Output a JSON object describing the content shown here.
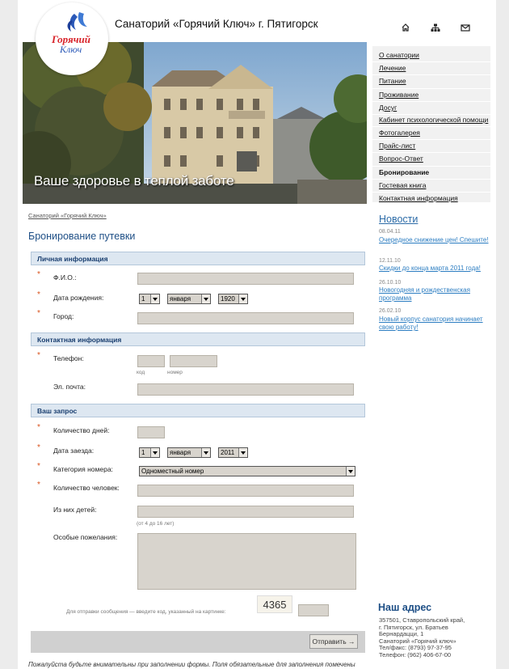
{
  "header": {
    "site_title": "Санаторий «Горячий Ключ» г. Пятигорск",
    "logo_text": "Горячий Ключ",
    "icons": [
      "home-icon",
      "sitemap-icon",
      "mail-icon"
    ]
  },
  "hero": {
    "slogan": "Ваше здоровье в теплой заботе"
  },
  "nav": {
    "items": [
      "О санатории",
      "Лечение",
      "Питание",
      "Проживание",
      "Досуг",
      "Кабинет психологической помощи",
      "Фотогалерея",
      "Прайс-лист",
      "Вопрос-Ответ",
      "Бронирование",
      "Гостевая книга",
      "Контактная информация"
    ],
    "active": "Бронирование"
  },
  "breadcrumb": "Санаторий «Горячий Ключ»",
  "form": {
    "title": "Бронирование путевки",
    "sections": {
      "personal": "Личная информация",
      "contact": "Контактная информация",
      "request": "Ваш запрос"
    },
    "fio_label": "Ф.И.О.:",
    "birth_label": "Дата рождения:",
    "birth_day": "1",
    "birth_month": "января",
    "birth_year": "1920",
    "city_label": "Город:",
    "phone_label": "Телефон:",
    "phone_code_hint": "код",
    "phone_number_hint": "номер",
    "email_label": "Эл. почта:",
    "days_label": "Количество дней:",
    "arrival_label": "Дата заезда:",
    "arrival_day": "1",
    "arrival_month": "января",
    "arrival_year": "2011",
    "category_label": "Категория номера:",
    "category_value": "Одноместный номер",
    "persons_label": "Количество человек:",
    "children_label": "Из них детей:",
    "children_hint": "(от 4 до 16 лет)",
    "wishes_label": "Особые пожелания:",
    "captcha_text": "Для отправки сообщения — введите код, указанный на картинке:",
    "captcha_code": "4365",
    "submit_label": "Отправить →",
    "note": "Пожалуйста будьте внимательны при заполнении формы. Поля обязательные для заполнения помечены"
  },
  "news": {
    "title": "Новости",
    "items": [
      {
        "date": "08.04.11",
        "text": "Очередное снижение цен! Спешите!"
      },
      {
        "date": "12.11.10",
        "text": "Скидки до конца марта 2011 года!"
      },
      {
        "date": "26.10.10",
        "text": "Новогодняя и рождественская программа"
      },
      {
        "date": "26.02.10",
        "text": "Новый корпус санатория начинает свою работу!"
      }
    ]
  },
  "address": {
    "title": "Наш адрес",
    "text": "357501, Ставропольский край,\nг. Пятигорск, ул. Братьев\nБернардацци, 1\nСанаторий «Горячий ключ»\nТел/факс: (8793) 97-37-95\nТелефон: (962) 406-67-00"
  },
  "colors": {
    "accent": "#1e4f86",
    "link": "#2d7ec2",
    "required": "#d9531e",
    "section_bg": "#dde7f1"
  }
}
